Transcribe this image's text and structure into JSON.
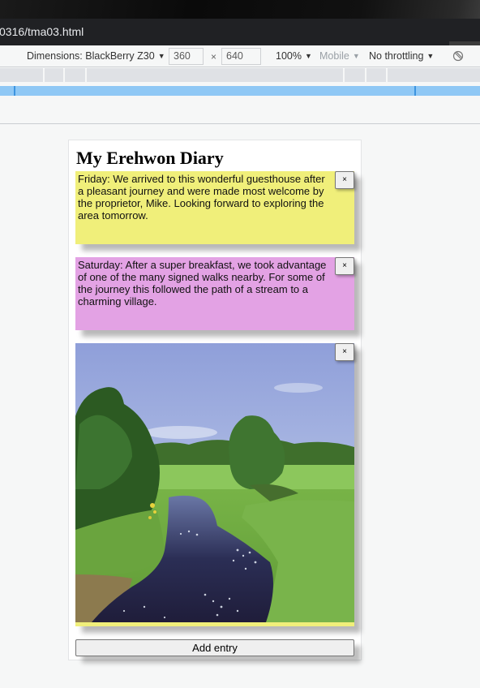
{
  "browser": {
    "url": "0316/tma03.html"
  },
  "device_toolbar": {
    "dimensions_label": "Dimensions: BlackBerry Z30",
    "width_value": "360",
    "times_symbol": "×",
    "height_value": "640",
    "zoom_label": "100%",
    "mobile_label": "Mobile",
    "throttling_label": "No throttling",
    "dropdown_arrow": "▼"
  },
  "page": {
    "title": "My Erehwon Diary",
    "entries": [
      {
        "type": "text",
        "text": "Friday: We arrived to this wonderful guesthouse after a pleasant journey and were made most welcome by the proprietor, Mike. Looking forward to exploring the area tomorrow.",
        "color": "#f0ef7a",
        "close_label": "×"
      },
      {
        "type": "text",
        "text": "Saturday: After a super breakfast, we took advantage of one of the many signed walks nearby. For some of the journey this followed the path of a stream to a charming village.",
        "color": "#e3a2e4",
        "close_label": "×"
      },
      {
        "type": "image",
        "image_description": "A stream winding through green meadows with trees under a blue sky",
        "color": "#f0ef7a",
        "close_label": "×"
      }
    ],
    "add_entry_label": "Add entry"
  }
}
